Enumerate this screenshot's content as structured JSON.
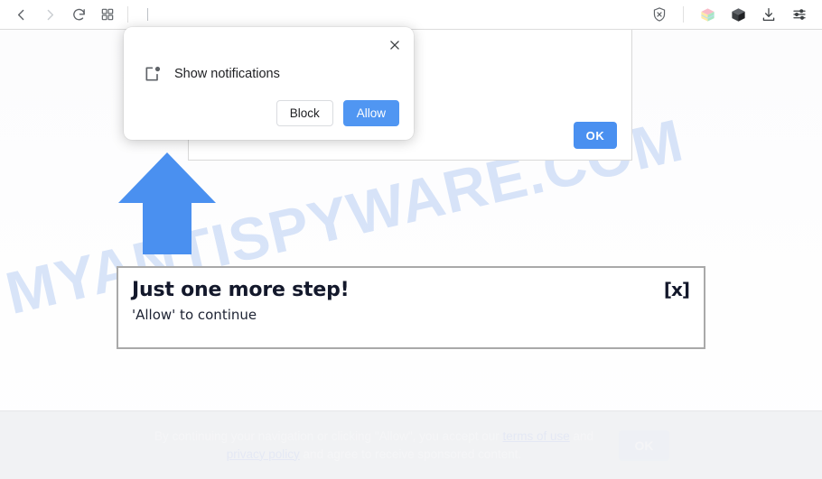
{
  "browser": {
    "back_label": "Back",
    "forward_label": "Forward",
    "reload_label": "Reload",
    "apps_label": "Apps",
    "url_value": "",
    "url_placeholder": "",
    "extensions": [
      {
        "name": "shield-x-icon",
        "title": "Blocker"
      },
      {
        "name": "colored-cube-icon",
        "title": "Extension"
      },
      {
        "name": "dark-cube-icon",
        "title": "Extension"
      },
      {
        "name": "download-icon",
        "title": "Downloads"
      },
      {
        "name": "sliders-icon",
        "title": "Settings"
      }
    ]
  },
  "permission_dialog": {
    "close_label": "✕",
    "icon_name": "notification-badge-icon",
    "message": "Show notifications",
    "block_label": "Block",
    "allow_label": "Allow"
  },
  "site_panel": {
    "ok_label": "OK"
  },
  "promo": {
    "title": "Just one more step!",
    "subtitle": "'Allow' to continue",
    "close_label": "[x]"
  },
  "consent": {
    "text_part1": "By continuing your navigation or clicking \"Allow\", you accept our ",
    "link_terms": "terms of use",
    "text_part2": " and ",
    "link_privacy": "privacy policy",
    "text_part3": " and agree to receive sponsored content.",
    "ok_label": "OK"
  },
  "watermark": {
    "text": "MYANTISPYWARE.COM"
  },
  "colors": {
    "accent_blue": "#5096f2",
    "arrow_blue": "#4a90f0",
    "panel_border": "#a9a9a9",
    "banner_bg": "#f1f2f4",
    "watermark": "#82aaeb"
  }
}
